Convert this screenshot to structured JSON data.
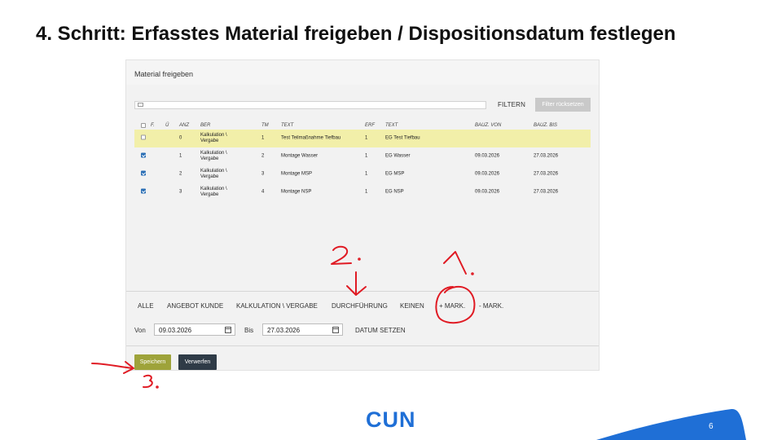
{
  "slide": {
    "title": "4. Schritt: Erfasstes Material freigeben / Dispositionsdatum festlegen",
    "page_number": "6",
    "logo_text": "CUN",
    "accent_color": "#1f6fd6"
  },
  "dialog": {
    "title": "Material freigeben",
    "search_placeholder": "",
    "filter_label": "FILTERN",
    "reset_label": "Filter rücksetzen",
    "columns": [
      "F.",
      "Ü",
      "ANZ",
      "BER",
      "TM",
      "TEXT",
      "ERF",
      "TEXT",
      "BAUZ. VON",
      "BAUZ. BIS"
    ],
    "rows": [
      {
        "checked": false,
        "anz": "0",
        "ber1": "Kalkulation \\",
        "ber2": "Vergabe",
        "tm": "1",
        "text": "Test Teilmaßnahme Tiefbau",
        "erf": "1",
        "text2": "EG Test Tiefbau",
        "von": "",
        "bis": ""
      },
      {
        "checked": true,
        "anz": "1",
        "ber1": "Kalkulation \\",
        "ber2": "Vergabe",
        "tm": "2",
        "text": "Montage Wasser",
        "erf": "1",
        "text2": "EG Wasser",
        "von": "09.03.2026",
        "bis": "27.03.2026"
      },
      {
        "checked": true,
        "anz": "2",
        "ber1": "Kalkulation \\",
        "ber2": "Vergabe",
        "tm": "3",
        "text": "Montage MSP",
        "erf": "1",
        "text2": "EG MSP",
        "von": "09.03.2026",
        "bis": "27.03.2026"
      },
      {
        "checked": true,
        "anz": "3",
        "ber1": "Kalkulation \\",
        "ber2": "Vergabe",
        "tm": "4",
        "text": "Montage NSP",
        "erf": "1",
        "text2": "EG NSP",
        "von": "09.03.2026",
        "bis": "27.03.2026"
      }
    ],
    "highlight_color": "#f2efa9",
    "quick_filters": {
      "all": "ALLE",
      "offer": "ANGEBOT KUNDE",
      "calc": "KALKULATION \\ VERGABE",
      "exec": "DURCHFÜHRUNG",
      "none": "KEINEN",
      "mark_add": "+ MARK.",
      "mark_remove": "- MARK."
    },
    "dates": {
      "from_label": "Von",
      "from_value": "09.03.2026",
      "to_label": "Bis",
      "to_value": "27.03.2026",
      "set_label": "DATUM SETZEN"
    },
    "save_label": "Speichern",
    "discard_label": "Verwerfen",
    "save_color": "#9ea33a",
    "discard_color": "#2f3b47"
  },
  "annotations": {
    "step1": "1.",
    "step2": "2.",
    "step3": "3.",
    "color": "#e01b24"
  }
}
